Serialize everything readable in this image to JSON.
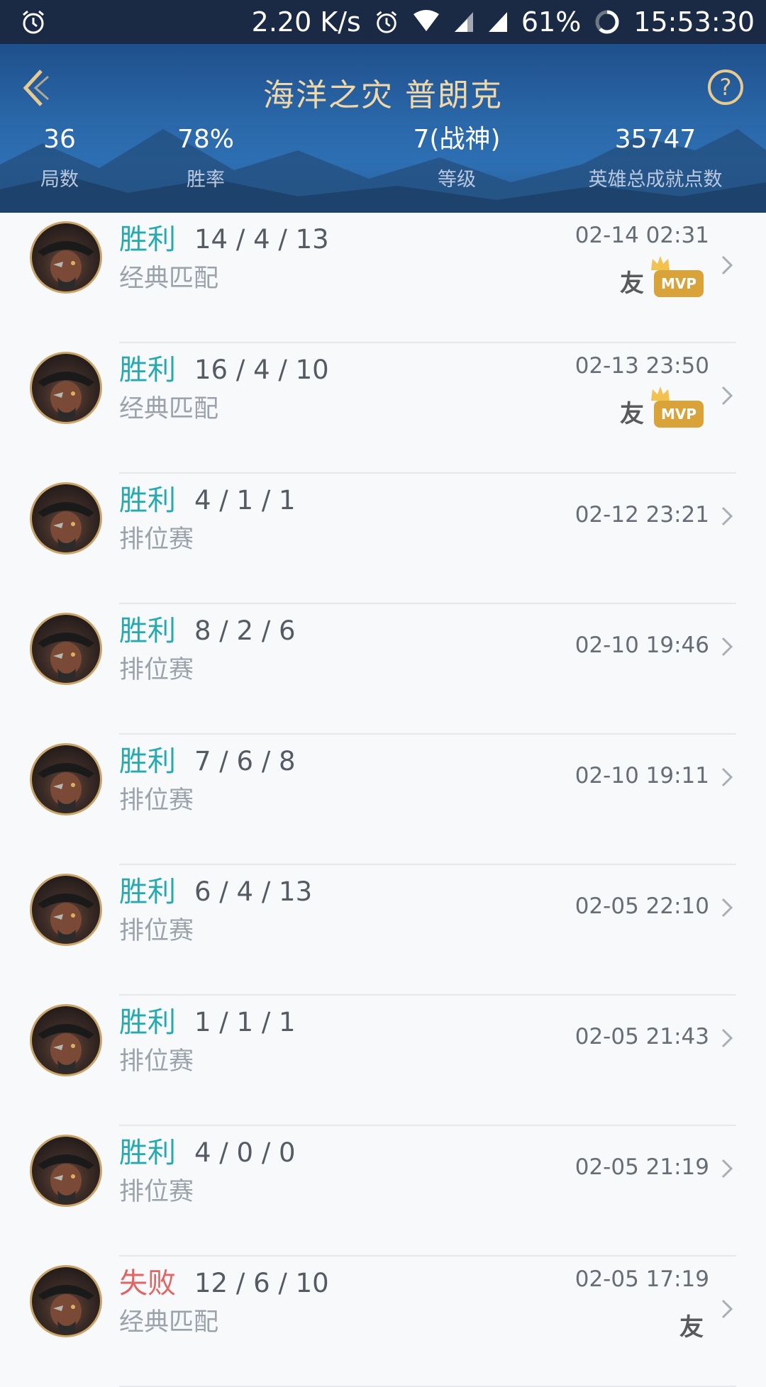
{
  "status_bar": {
    "speed": "2.20 K/s",
    "battery": "61%",
    "time": "15:53:30"
  },
  "header": {
    "title": "海洋之灾 普朗克",
    "stats": [
      {
        "value": "36",
        "label": "局数"
      },
      {
        "value": "78%",
        "label": "胜率"
      },
      {
        "value": "7(战神)",
        "label": "等级"
      },
      {
        "value": "35747",
        "label": "英雄总成就点数"
      }
    ]
  },
  "matches": [
    {
      "result": "胜利",
      "outcome": "win",
      "kda": "14 / 4 / 13",
      "mode": "经典匹配",
      "time": "02-14 02:31",
      "friend": "友",
      "mvp": "MVP"
    },
    {
      "result": "胜利",
      "outcome": "win",
      "kda": "16 / 4 / 10",
      "mode": "经典匹配",
      "time": "02-13 23:50",
      "friend": "友",
      "mvp": "MVP"
    },
    {
      "result": "胜利",
      "outcome": "win",
      "kda": "4 / 1 / 1",
      "mode": "排位赛",
      "time": "02-12 23:21"
    },
    {
      "result": "胜利",
      "outcome": "win",
      "kda": "8 / 2 / 6",
      "mode": "排位赛",
      "time": "02-10 19:46"
    },
    {
      "result": "胜利",
      "outcome": "win",
      "kda": "7 / 6 / 8",
      "mode": "排位赛",
      "time": "02-10 19:11"
    },
    {
      "result": "胜利",
      "outcome": "win",
      "kda": "6 / 4 / 13",
      "mode": "排位赛",
      "time": "02-05 22:10"
    },
    {
      "result": "胜利",
      "outcome": "win",
      "kda": "1 / 1 / 1",
      "mode": "排位赛",
      "time": "02-05 21:43"
    },
    {
      "result": "胜利",
      "outcome": "win",
      "kda": "4 / 0 / 0",
      "mode": "排位赛",
      "time": "02-05 21:19"
    },
    {
      "result": "失败",
      "outcome": "lose",
      "kda": "12 / 6 / 10",
      "mode": "经典匹配",
      "time": "02-05 17:19",
      "friend": "友"
    }
  ],
  "icons": {
    "back": "chevron-left-icon",
    "help": "question-icon",
    "row_nav": "chevron-right-icon",
    "avatar": "hero-avatar"
  },
  "colors": {
    "win": "#27a9b0",
    "lose": "#e06565",
    "title": "#f0d7a8",
    "mvp": "#d9a33a"
  }
}
